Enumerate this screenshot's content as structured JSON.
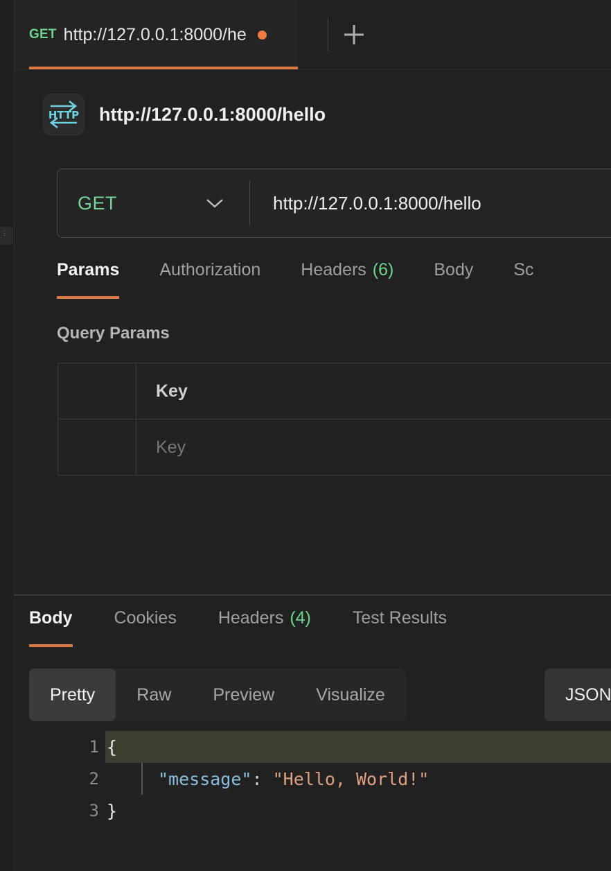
{
  "tab_strip": {
    "active_tab": {
      "method": "GET",
      "title": "http://127.0.0.1:8000/he",
      "unsaved_indicator": "unsaved-dot"
    },
    "new_tab_label": "+"
  },
  "request": {
    "protocol_badge": "HTTP",
    "name": "http://127.0.0.1:8000/hello",
    "method": "GET",
    "method_chevron": "chevron-down-icon",
    "url": "http://127.0.0.1:8000/hello",
    "tabs": [
      {
        "label": "Params",
        "count": "",
        "active": true
      },
      {
        "label": "Authorization",
        "count": "",
        "active": false
      },
      {
        "label": "Headers",
        "count": "(6)",
        "active": false
      },
      {
        "label": "Body",
        "count": "",
        "active": false
      },
      {
        "label": "Sc",
        "count": "",
        "active": false
      }
    ],
    "query_params": {
      "section_title": "Query Params",
      "columns": [
        "",
        "Key"
      ],
      "rows": [
        {
          "key_placeholder": "Key"
        }
      ]
    }
  },
  "response": {
    "tabs": [
      {
        "label": "Body",
        "count": "",
        "active": true
      },
      {
        "label": "Cookies",
        "count": "",
        "active": false
      },
      {
        "label": "Headers",
        "count": "(4)",
        "active": false
      },
      {
        "label": "Test Results",
        "count": "",
        "active": false
      }
    ],
    "format_modes": [
      {
        "label": "Pretty",
        "active": true
      },
      {
        "label": "Raw",
        "active": false
      },
      {
        "label": "Preview",
        "active": false
      },
      {
        "label": "Visualize",
        "active": false
      }
    ],
    "content_type": "JSON",
    "body_lines": [
      {
        "number": "1",
        "highlighted": true,
        "brace": "{",
        "key": "",
        "colon": "",
        "value": ""
      },
      {
        "number": "2",
        "highlighted": false,
        "brace": "",
        "key": "\"message\"",
        "colon": ":",
        "value": "\"Hello, World!\""
      },
      {
        "number": "3",
        "highlighted": false,
        "brace": "}",
        "key": "",
        "colon": "",
        "value": ""
      }
    ]
  },
  "colors": {
    "accent_orange": "#e07a45",
    "method_green": "#6bd68a",
    "count_green": "#6bd68a",
    "protocol_cyan": "#6fd2e0",
    "json_key": "#8bbfe0",
    "json_string": "#e0a080",
    "active_line": "#3c3e30",
    "background": "#212121"
  }
}
